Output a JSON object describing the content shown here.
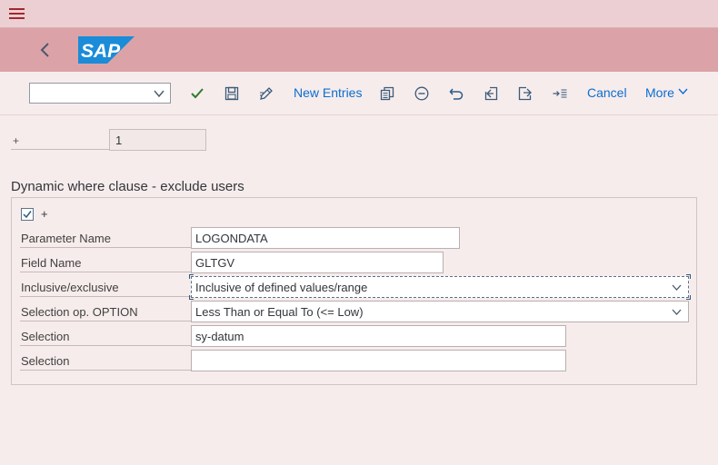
{
  "toolbar": {
    "dropdown_value": "",
    "new_entries_label": "New Entries",
    "cancel_label": "Cancel",
    "more_label": "More"
  },
  "ruler": {
    "label": "+",
    "value": "1"
  },
  "section": {
    "title": "Dynamic where clause - exclude users",
    "checkbox_label": "+"
  },
  "fields": {
    "parameter_name": {
      "label": "Parameter Name",
      "value": "LOGONDATA"
    },
    "field_name": {
      "label": "Field Name",
      "value": "GLTGV"
    },
    "inclusive": {
      "label": "Inclusive/exclusive",
      "value": "Inclusive of defined values/range"
    },
    "option": {
      "label": "Selection op. OPTION",
      "value": "Less Than or Equal To (<= Low)"
    },
    "selection_1": {
      "label": "Selection",
      "value": "sy-datum"
    },
    "selection_2": {
      "label": "Selection",
      "value": ""
    }
  },
  "colors": {
    "brand": "#0a6ed1",
    "topbar": "#eccfd2",
    "header": "#dba3a7",
    "background": "#f7ecec",
    "accept_green": "#2b7c2b"
  },
  "icons": [
    "menu-icon",
    "back-icon",
    "sap-logo",
    "check-icon",
    "save-icon",
    "edit-icon",
    "copy-icon",
    "delete-icon",
    "undo-icon",
    "previous-icon",
    "next-icon",
    "indent-icon",
    "chevron-down-icon"
  ]
}
